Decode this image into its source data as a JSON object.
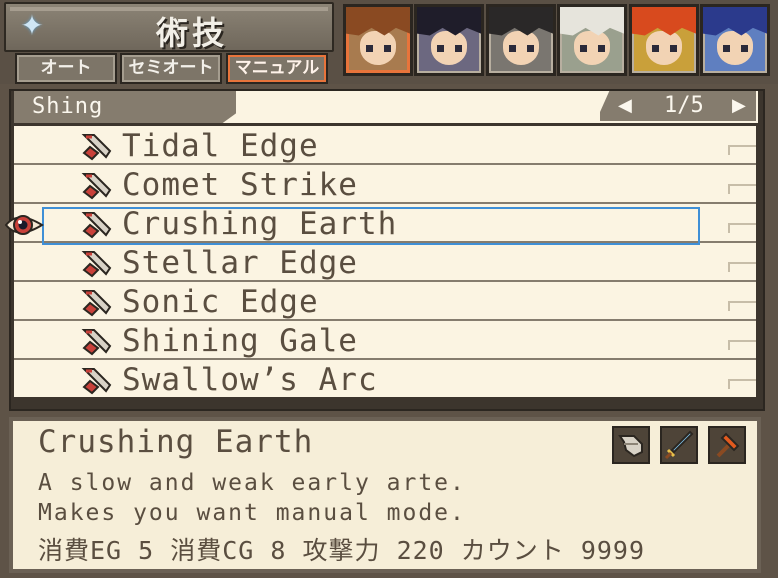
{
  "header": {
    "title": "術技",
    "modes": [
      {
        "label": "オート",
        "active": false
      },
      {
        "label": "セミオート",
        "active": false
      },
      {
        "label": "マニュアル",
        "active": true
      }
    ],
    "party": [
      {
        "name": "party-member-1",
        "hair": "#8a4a22",
        "bg": "#a87b4f",
        "active": true
      },
      {
        "name": "party-member-2",
        "hair": "#1f1d2a",
        "bg": "#6c6880",
        "active": false
      },
      {
        "name": "party-member-3",
        "hair": "#2a2828",
        "bg": "#7a7670",
        "active": false
      },
      {
        "name": "party-member-4",
        "hair": "#e6e4dc",
        "bg": "#9aa08e",
        "active": false
      },
      {
        "name": "party-member-5",
        "hair": "#d84a1e",
        "bg": "#c9a03a",
        "active": false
      },
      {
        "name": "party-member-6",
        "hair": "#2b3a8c",
        "bg": "#5f7fc0",
        "active": false
      }
    ]
  },
  "list": {
    "section": "Shing",
    "page": "1/5",
    "selected_index": 2,
    "artes": [
      "Tidal Edge",
      "Comet Strike",
      "Crushing Earth",
      "Stellar Edge",
      "Sonic Edge",
      "Shining Gale",
      "Swallow’s Arc"
    ]
  },
  "description": {
    "title": "Crushing Earth",
    "lines": [
      "A slow and weak early arte.",
      "Makes you want manual mode."
    ],
    "stats": "消費EG  5 消費CG  8 攻撃力  220 カウント 9999"
  },
  "colors": {
    "accent": "#e8743b",
    "selection": "#3f8fd6",
    "panel": "#fbf4e2"
  }
}
